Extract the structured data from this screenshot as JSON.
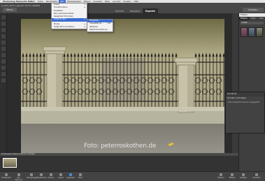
{
  "menubar": {
    "app": "Photoshop Elements Editor",
    "items": [
      "Datei",
      "Bearbeiten",
      "Bild",
      "Überarbeiten",
      "Ebene",
      "Auswahl",
      "Filter",
      "Ansicht",
      "Fenster",
      "Hilfe"
    ],
    "active_index": 3
  },
  "topbar": {
    "doc_tab": "0_DSC_0031 (.jpg bei 16,7% (RGB/8)",
    "open_label": "Öffnen",
    "modes": [
      "Schnell",
      "Assistent",
      "Experte"
    ],
    "active_mode": 2,
    "create_label": "Erstellen"
  },
  "dropdown": {
    "items": [
      {
        "label": "Direkt",
        "has_sub": true
      },
      {
        "label": "Transformieren",
        "has_sub": true
      },
      {
        "label": "Freistellen",
        "has_sub": false
      },
      {
        "label": "Neu zusammensetzen",
        "has_sub": false
      },
      {
        "label": "Gesamtes Foto teilen",
        "has_sub": false
      },
      {
        "label": "Größe ändern",
        "has_sub": true
      },
      {
        "label": "",
        "has_sub": false
      },
      {
        "label": "Modus",
        "has_sub": true
      },
      {
        "label": "Farbprofil konvertieren",
        "has_sub": true
      }
    ],
    "active_index": 5
  },
  "submenu": {
    "items": [
      {
        "label": "Bildgröße...",
        "shortcut": ""
      },
      {
        "label": "Arbeitsfläche...",
        "shortcut": "⌥⌘C"
      },
      {
        "label": "Skalieren",
        "shortcut": ""
      },
      {
        "label": "Stapelverarbeitung...",
        "shortcut": ""
      }
    ],
    "active_index": 0
  },
  "right_panel": {
    "header": "Effekte",
    "tabs": [
      "Effekte",
      "Filter",
      "Stile"
    ],
    "active_tab": 0,
    "select_value": "Artistic"
  },
  "info_panel": {
    "header": "Info-Werte",
    "title": "Korrektur hinzufügen",
    "body": "Keine Dateiinformationen ausgewählt"
  },
  "bin": {
    "header": "Fotobereich  Offene Dateien anzeigen"
  },
  "bottom_bar": {
    "items": [
      "Fotobereich",
      "Wz.-Optionen",
      "Rückgängig",
      "Wiederholen",
      "Drehen",
      "Layout",
      "Organizer",
      "Start"
    ],
    "right_items": [
      "Ebenen",
      "Effekte",
      "Grafiken",
      "Favoriten"
    ]
  },
  "photo": {
    "watermark": "Foto: peterroskothen.de"
  }
}
